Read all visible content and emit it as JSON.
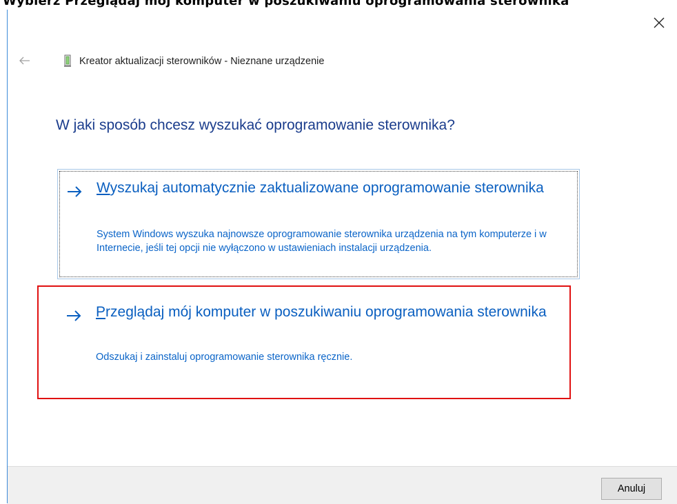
{
  "header_caption": "Wybierz Przeglądaj mój komputer w poszukiwaniu oprogramowania sterownika",
  "dialog": {
    "title": "Kreator aktualizacji sterowników - Nieznane urządzenie",
    "question": "W jaki sposób chcesz wyszukać oprogramowanie sterownika?",
    "icons": {
      "close": "close-icon",
      "back": "back-arrow-icon",
      "device": "device-icon",
      "option_arrow": "arrow-right-icon"
    }
  },
  "options": [
    {
      "accel": "W",
      "title_rest": "yszukaj automatycznie zaktualizowane oprogramowanie sterownika",
      "description": "System Windows wyszuka najnowsze oprogramowanie sterownika urządzenia na tym komputerze i w Internecie, jeśli tej opcji nie wyłączono w ustawieniach instalacji urządzenia."
    },
    {
      "accel": "P",
      "title_rest": "rzeglądaj mój komputer w poszukiwaniu oprogramowania sterownika",
      "description": "Odszukaj i zainstaluj oprogramowanie sterownika ręcznie."
    }
  ],
  "footer": {
    "cancel_label": "Anuluj"
  },
  "colors": {
    "link": "#0a5fc0",
    "heading": "#1a3c8c",
    "highlight": "#e01010",
    "window_border": "#3c8ad8"
  }
}
